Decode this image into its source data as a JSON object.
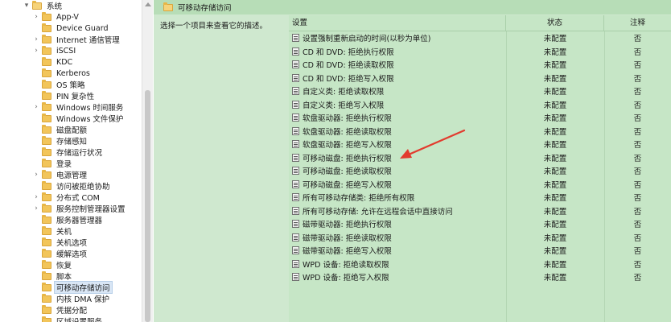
{
  "tree": {
    "items": [
      {
        "label": "系统",
        "chevron": "▾",
        "open": true,
        "indent": 0
      },
      {
        "label": "App-V",
        "chevron": "›",
        "indent": 1
      },
      {
        "label": "Device Guard",
        "chevron": "",
        "indent": 1
      },
      {
        "label": "Internet 通信管理",
        "chevron": "›",
        "indent": 1
      },
      {
        "label": "iSCSI",
        "chevron": "›",
        "indent": 1
      },
      {
        "label": "KDC",
        "chevron": "",
        "indent": 1
      },
      {
        "label": "Kerberos",
        "chevron": "",
        "indent": 1
      },
      {
        "label": "OS 策略",
        "chevron": "",
        "indent": 1
      },
      {
        "label": "PIN 复杂性",
        "chevron": "",
        "indent": 1
      },
      {
        "label": "Windows 时间服务",
        "chevron": "›",
        "indent": 1
      },
      {
        "label": "Windows 文件保护",
        "chevron": "",
        "indent": 1
      },
      {
        "label": "磁盘配额",
        "chevron": "",
        "indent": 1
      },
      {
        "label": "存储感知",
        "chevron": "",
        "indent": 1
      },
      {
        "label": "存储运行状况",
        "chevron": "",
        "indent": 1
      },
      {
        "label": "登录",
        "chevron": "",
        "indent": 1
      },
      {
        "label": "电源管理",
        "chevron": "›",
        "indent": 1
      },
      {
        "label": "访问被拒绝协助",
        "chevron": "",
        "indent": 1
      },
      {
        "label": "分布式 COM",
        "chevron": "›",
        "indent": 1
      },
      {
        "label": "服务控制管理器设置",
        "chevron": "›",
        "indent": 1
      },
      {
        "label": "服务器管理器",
        "chevron": "",
        "indent": 1
      },
      {
        "label": "关机",
        "chevron": "",
        "indent": 1
      },
      {
        "label": "关机选项",
        "chevron": "",
        "indent": 1
      },
      {
        "label": "缓解选项",
        "chevron": "",
        "indent": 1
      },
      {
        "label": "恢复",
        "chevron": "",
        "indent": 1
      },
      {
        "label": "脚本",
        "chevron": "",
        "indent": 1
      },
      {
        "label": "可移动存储访问",
        "chevron": "",
        "indent": 1,
        "selected": true
      },
      {
        "label": "内核 DMA 保护",
        "chevron": "",
        "indent": 1
      },
      {
        "label": "凭据分配",
        "chevron": "",
        "indent": 1
      },
      {
        "label": "区域设置服务",
        "chevron": "",
        "indent": 1
      }
    ]
  },
  "header": {
    "title": "可移动存储访问"
  },
  "description": {
    "text": "选择一个项目来查看它的描述。"
  },
  "table": {
    "columns": {
      "setting": "设置",
      "state": "状态",
      "comment": "注释"
    },
    "rows": [
      {
        "setting": "设置强制重新启动的时间(以秒为单位)",
        "state": "未配置",
        "comment": "否"
      },
      {
        "setting": "CD 和 DVD: 拒绝执行权限",
        "state": "未配置",
        "comment": "否"
      },
      {
        "setting": "CD 和 DVD: 拒绝读取权限",
        "state": "未配置",
        "comment": "否"
      },
      {
        "setting": "CD 和 DVD: 拒绝写入权限",
        "state": "未配置",
        "comment": "否"
      },
      {
        "setting": "自定义类: 拒绝读取权限",
        "state": "未配置",
        "comment": "否"
      },
      {
        "setting": "自定义类: 拒绝写入权限",
        "state": "未配置",
        "comment": "否"
      },
      {
        "setting": "软盘驱动器: 拒绝执行权限",
        "state": "未配置",
        "comment": "否"
      },
      {
        "setting": "软盘驱动器: 拒绝读取权限",
        "state": "未配置",
        "comment": "否"
      },
      {
        "setting": "软盘驱动器: 拒绝写入权限",
        "state": "未配置",
        "comment": "否"
      },
      {
        "setting": "可移动磁盘: 拒绝执行权限",
        "state": "未配置",
        "comment": "否"
      },
      {
        "setting": "可移动磁盘: 拒绝读取权限",
        "state": "未配置",
        "comment": "否"
      },
      {
        "setting": "可移动磁盘: 拒绝写入权限",
        "state": "未配置",
        "comment": "否"
      },
      {
        "setting": "所有可移动存储类: 拒绝所有权限",
        "state": "未配置",
        "comment": "否"
      },
      {
        "setting": "所有可移动存储: 允许在远程会话中直接访问",
        "state": "未配置",
        "comment": "否"
      },
      {
        "setting": "磁带驱动器: 拒绝执行权限",
        "state": "未配置",
        "comment": "否"
      },
      {
        "setting": "磁带驱动器: 拒绝读取权限",
        "state": "未配置",
        "comment": "否"
      },
      {
        "setting": "磁带驱动器: 拒绝写入权限",
        "state": "未配置",
        "comment": "否"
      },
      {
        "setting": "WPD 设备: 拒绝读取权限",
        "state": "未配置",
        "comment": "否"
      },
      {
        "setting": "WPD 设备: 拒绝写入权限",
        "state": "未配置",
        "comment": "否"
      }
    ]
  },
  "colors": {
    "pane_green": "#cfe8cf",
    "header_green": "#b7ddb7",
    "arrow_red": "#e23b2e",
    "folder_yellow": "#f2c55a"
  },
  "icons": {
    "tree_folder": "folder-icon",
    "policy_setting": "policy-setting-icon"
  }
}
